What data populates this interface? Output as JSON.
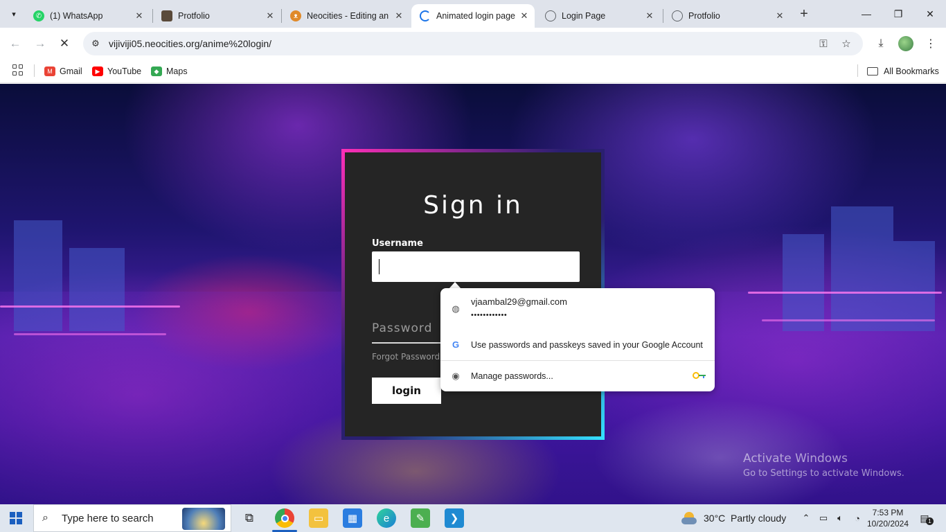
{
  "tabs": [
    {
      "title": "(1) WhatsApp",
      "icon": "whatsapp-icon",
      "color": "#25d366",
      "active": false
    },
    {
      "title": "Protfolio",
      "icon": "portfolio-avatar-icon",
      "color": "#5a4a3a",
      "active": false
    },
    {
      "title": "Neocities - Editing an",
      "icon": "neocities-cat-icon",
      "color": "#e08a2a",
      "active": false
    },
    {
      "title": "Animated login page",
      "icon": "loading-spinner-icon",
      "color": "#1a73e8",
      "active": true
    },
    {
      "title": "Login Page",
      "icon": "globe-icon",
      "color": "#5f6368",
      "active": false
    },
    {
      "title": "Protfolio",
      "icon": "globe-icon",
      "color": "#5f6368",
      "active": false
    }
  ],
  "address_bar": {
    "url": "vijiviji05.neocities.org/anime%20login/"
  },
  "bookmarks": [
    {
      "label": "Gmail",
      "icon": "gmail-icon",
      "color": "#ea4335"
    },
    {
      "label": "YouTube",
      "icon": "youtube-icon",
      "color": "#ff0000"
    },
    {
      "label": "Maps",
      "icon": "maps-icon",
      "color": "#34a853"
    }
  ],
  "bookmarks_folder": "All Bookmarks",
  "login": {
    "title": "Sign in",
    "username_label": "Username",
    "username_value": "",
    "password_placeholder": "Password",
    "forgot_link": "Forgot Password",
    "login_button": "login"
  },
  "password_popup": {
    "email": "vjaambal29@gmail.com",
    "password_mask": "••••••••••••",
    "google_text": "Use passwords and passkeys saved in your Google Account",
    "manage_text": "Manage passwords..."
  },
  "watermark": {
    "line1": "Activate Windows",
    "line2": "Go to Settings to activate Windows."
  },
  "taskbar": {
    "search_placeholder": "Type here to search",
    "weather": "30°C  Partly cloudy",
    "time": "7:53 PM",
    "date": "10/20/2024",
    "notification_count": "1"
  },
  "colors": {
    "card_pink": "#ff2fb7",
    "card_cyan": "#34e3ff",
    "card_bg": "#252525"
  }
}
